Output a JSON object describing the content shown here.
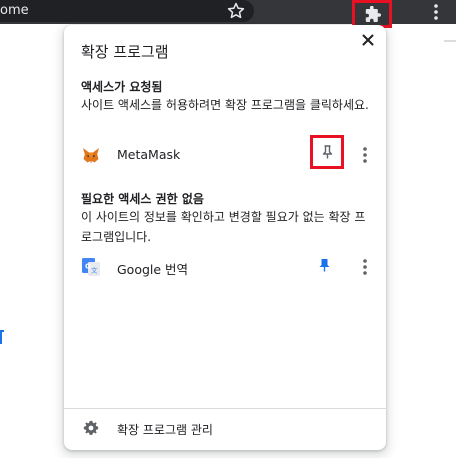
{
  "browser": {
    "omnibox_text": "ome"
  },
  "popup": {
    "title": "확장 프로그램",
    "close_icon": "close-icon",
    "access_requested": {
      "title": "액세스가 요청됨",
      "description": "사이트 액세스를 허용하려면 확장 프로그램을 클릭하세요.",
      "extensions": [
        {
          "name": "MetaMask",
          "icon": "fox-icon",
          "pinned": false
        }
      ]
    },
    "no_access_needed": {
      "title": "필요한 액세스 권한 없음",
      "description": "이 사이트의 정보를 확인하고 변경할 필요가 없는 확장 프로그램입니다.",
      "extensions": [
        {
          "name": "Google 번역",
          "icon": "google-translate-icon",
          "pinned": true
        }
      ]
    },
    "footer": {
      "manage_label": "확장 프로그램 관리",
      "icon": "gear-icon"
    }
  },
  "colors": {
    "toolbar": "#35363a",
    "omnibox": "#202124",
    "highlight": "#e81123",
    "accent": "#1a73e8",
    "text": "#202124",
    "icon_gray": "#5f6368"
  }
}
